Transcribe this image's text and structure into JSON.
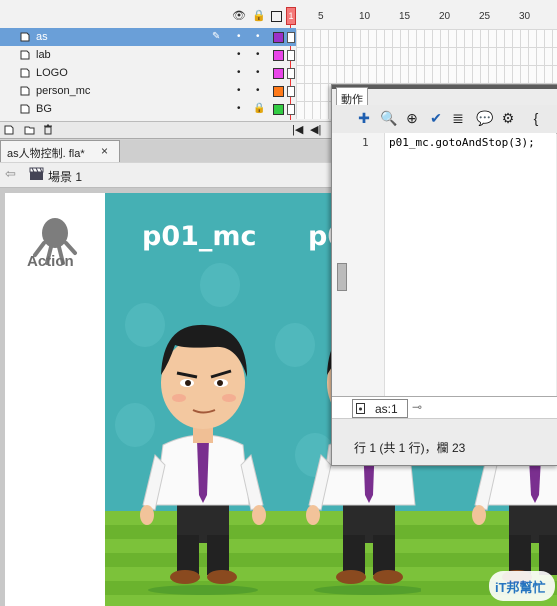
{
  "timeline": {
    "header_icons": [
      "eye-icon",
      "lock-icon",
      "outline-icon"
    ],
    "ruler": [
      "1",
      "5",
      "10",
      "15",
      "20",
      "25",
      "30"
    ],
    "layers": [
      {
        "name": "as",
        "selected": true,
        "color": "#9b30c8"
      },
      {
        "name": "lab",
        "selected": false,
        "color": "#e845e8"
      },
      {
        "name": "LOGO",
        "selected": false,
        "color": "#e845e8"
      },
      {
        "name": "person_mc",
        "selected": false,
        "color": "#ff7a1a"
      },
      {
        "name": "BG",
        "selected": false,
        "color": "#33cc44"
      }
    ]
  },
  "document": {
    "tab_label": "as人物控制. fla*",
    "close_glyph": "×"
  },
  "scene": {
    "label": "場景 1"
  },
  "stage": {
    "logo_text": "Action",
    "instance_labels": [
      "p01_mc",
      "p0"
    ],
    "watermark": "iT邦幫忙"
  },
  "actions_panel": {
    "tab_label": "動作",
    "line_number": "1",
    "code": "p01_mc.gotoAndStop(3);",
    "script_tab": "as:1",
    "status": "行 1 (共 1 行)，欄 23"
  },
  "colors": {
    "stage_bg": "#45b0b4",
    "selection": "#6a9fd8",
    "playhead": "#f47a7a"
  }
}
